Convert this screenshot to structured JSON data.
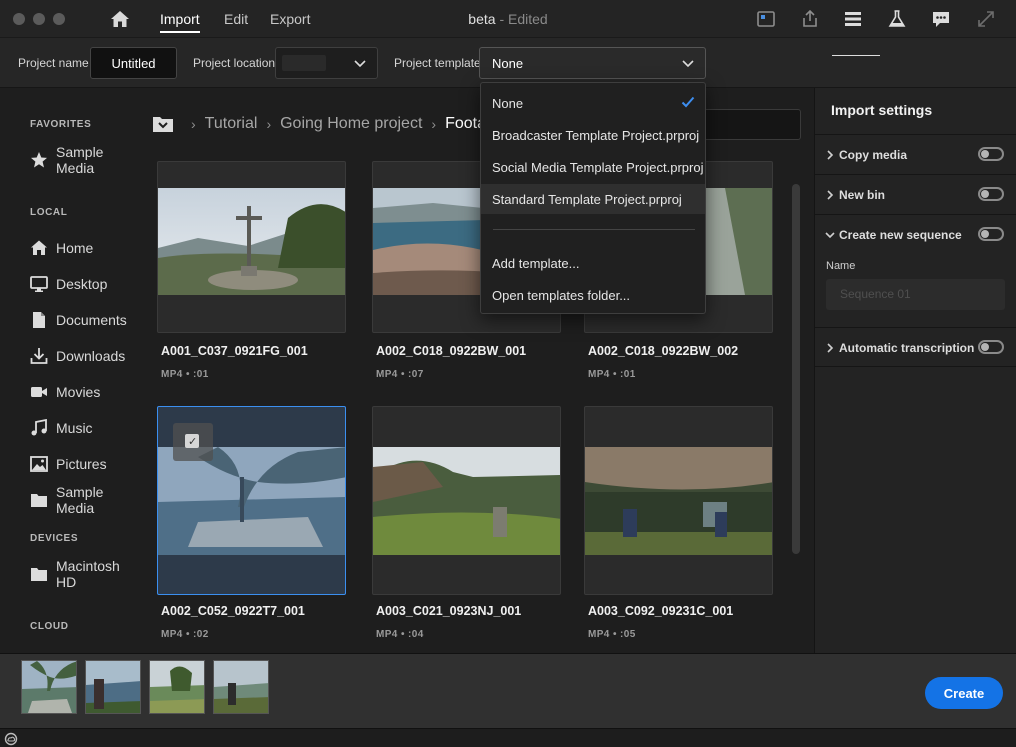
{
  "app": {
    "title": "beta",
    "title_state": "- Edited",
    "tabs": [
      {
        "label": "Import",
        "active": true
      },
      {
        "label": "Edit",
        "active": false
      },
      {
        "label": "Export",
        "active": false
      }
    ],
    "toolbar_icons": [
      "quick-export-icon",
      "share-icon",
      "workspaces-icon",
      "labs-icon",
      "feedback-icon",
      "fullscreen-icon"
    ]
  },
  "project": {
    "name_label": "Project name",
    "name_value": "Untitled",
    "location_label": "Project location",
    "location_value": "",
    "template_label": "Project template",
    "template_value": "None"
  },
  "template_dropdown": {
    "items": [
      "None",
      "Broadcaster Template Project.prproj",
      "Social Media Template Project.prproj",
      "Standard Template Project.prproj"
    ],
    "selected": "None",
    "hovered": "Standard Template Project.prproj",
    "actions": [
      "Add template...",
      "Open templates folder..."
    ]
  },
  "sidebar": {
    "favorites_heading": "FAVORITES",
    "favorites": [
      {
        "label": "Sample Media",
        "icon": "star-icon"
      }
    ],
    "local_heading": "LOCAL",
    "local": [
      {
        "label": "Home",
        "icon": "home-icon"
      },
      {
        "label": "Desktop",
        "icon": "monitor-icon"
      },
      {
        "label": "Documents",
        "icon": "document-icon"
      },
      {
        "label": "Downloads",
        "icon": "download-icon"
      },
      {
        "label": "Movies",
        "icon": "video-icon"
      },
      {
        "label": "Music",
        "icon": "music-icon"
      },
      {
        "label": "Pictures",
        "icon": "image-icon"
      },
      {
        "label": "Sample Media",
        "icon": "folder-icon"
      }
    ],
    "devices_heading": "DEVICES",
    "devices": [
      {
        "label": "Macintosh HD",
        "icon": "folder-icon"
      }
    ],
    "cloud_heading": "CLOUD"
  },
  "breadcrumb": [
    "Tutorial",
    "Going Home project",
    "Footage"
  ],
  "media": [
    {
      "name": "A001_C037_0921FG_001",
      "meta": "MP4 • :01",
      "selected": false
    },
    {
      "name": "A002_C018_0922BW_001",
      "meta": "MP4 • :07",
      "selected": false
    },
    {
      "name": "A002_C018_0922BW_002",
      "meta": "MP4 • :01",
      "selected": false
    },
    {
      "name": "A002_C052_0922T7_001",
      "meta": "MP4 • :02",
      "selected": true
    },
    {
      "name": "A003_C021_0923NJ_001",
      "meta": "MP4 • :04",
      "selected": false
    },
    {
      "name": "A003_C092_09231C_001",
      "meta": "MP4 • :05",
      "selected": false
    }
  ],
  "import_settings": {
    "title": "Import settings",
    "rows": [
      {
        "label": "Copy media",
        "on": false,
        "expanded": false
      },
      {
        "label": "New bin",
        "on": false,
        "expanded": false
      },
      {
        "label": "Create new sequence",
        "on": false,
        "expanded": true
      },
      {
        "label": "Automatic transcription",
        "on": false,
        "expanded": false
      }
    ],
    "sequence_name_label": "Name",
    "sequence_name_placeholder": "Sequence 01"
  },
  "tray": {
    "thumbnail_count": 4,
    "create_label": "Create"
  },
  "colors": {
    "accent": "#1473e6",
    "selection": "#3b8ff0",
    "background": "#1e1e1e"
  }
}
